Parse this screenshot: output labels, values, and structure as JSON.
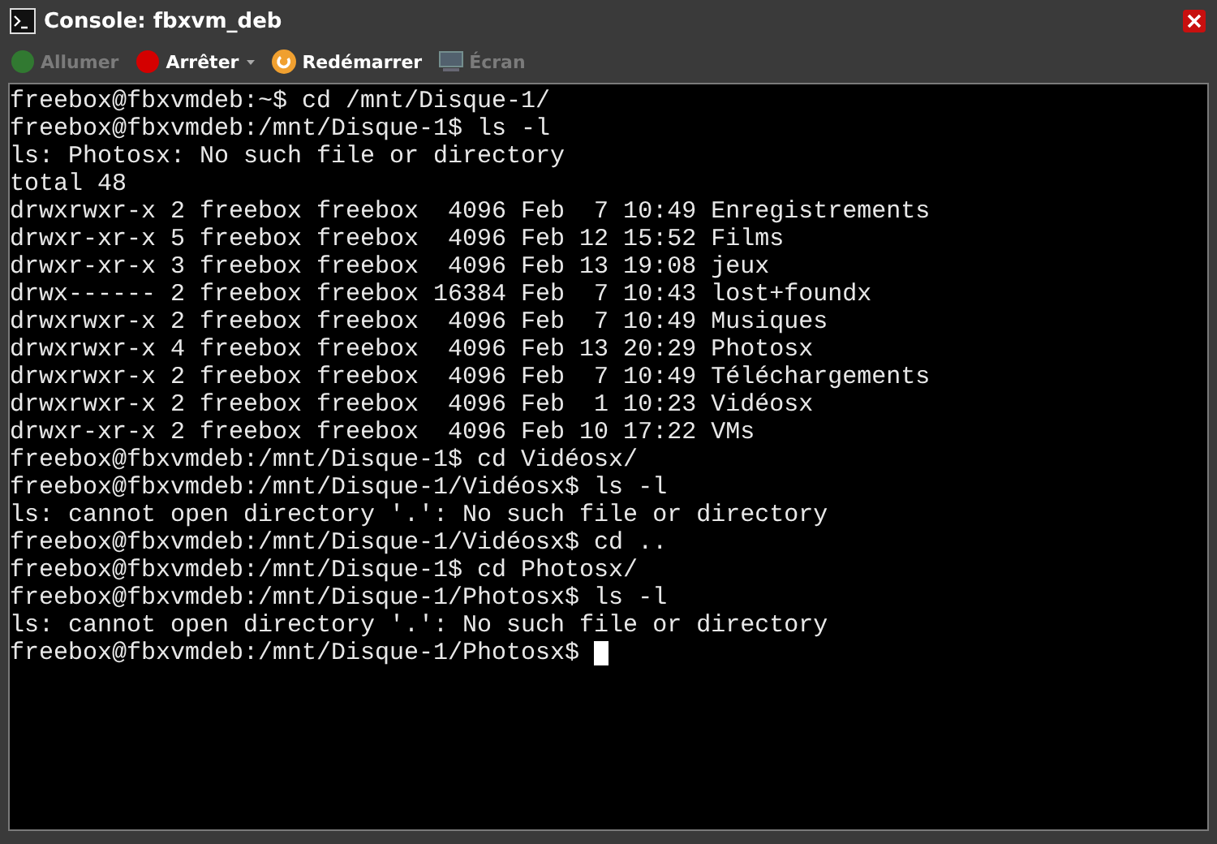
{
  "window": {
    "title": "Console: fbxvm_deb"
  },
  "toolbar": [
    {
      "kind": "power-on",
      "label": "Allumer",
      "disabled": true,
      "has_menu": false
    },
    {
      "kind": "stop",
      "label": "Arrêter",
      "disabled": false,
      "has_menu": true
    },
    {
      "kind": "restart",
      "label": "Redémarrer",
      "disabled": false,
      "has_menu": false
    },
    {
      "kind": "screen",
      "label": "Écran",
      "disabled": true,
      "has_menu": false
    }
  ],
  "terminal": {
    "lines": [
      "freebox@fbxvmdeb:~$ cd /mnt/Disque-1/",
      "freebox@fbxvmdeb:/mnt/Disque-1$ ls -l",
      "ls: Photosx: No such file or directory",
      "total 48",
      "drwxrwxr-x 2 freebox freebox  4096 Feb  7 10:49 Enregistrements",
      "drwxr-xr-x 5 freebox freebox  4096 Feb 12 15:52 Films",
      "drwxr-xr-x 3 freebox freebox  4096 Feb 13 19:08 jeux",
      "drwx------ 2 freebox freebox 16384 Feb  7 10:43 lost+foundx",
      "drwxrwxr-x 2 freebox freebox  4096 Feb  7 10:49 Musiques",
      "drwxrwxr-x 4 freebox freebox  4096 Feb 13 20:29 Photosx",
      "drwxrwxr-x 2 freebox freebox  4096 Feb  7 10:49 Téléchargements",
      "drwxrwxr-x 2 freebox freebox  4096 Feb  1 10:23 Vidéosx",
      "drwxr-xr-x 2 freebox freebox  4096 Feb 10 17:22 VMs",
      "freebox@fbxvmdeb:/mnt/Disque-1$ cd Vidéosx/",
      "freebox@fbxvmdeb:/mnt/Disque-1/Vidéosx$ ls -l",
      "ls: cannot open directory '.': No such file or directory",
      "freebox@fbxvmdeb:/mnt/Disque-1/Vidéosx$ cd ..",
      "freebox@fbxvmdeb:/mnt/Disque-1$ cd Photosx/",
      "freebox@fbxvmdeb:/mnt/Disque-1/Photosx$ ls -l",
      "ls: cannot open directory '.': No such file or directory",
      "freebox@fbxvmdeb:/mnt/Disque-1/Photosx$ "
    ],
    "cursor": true
  }
}
